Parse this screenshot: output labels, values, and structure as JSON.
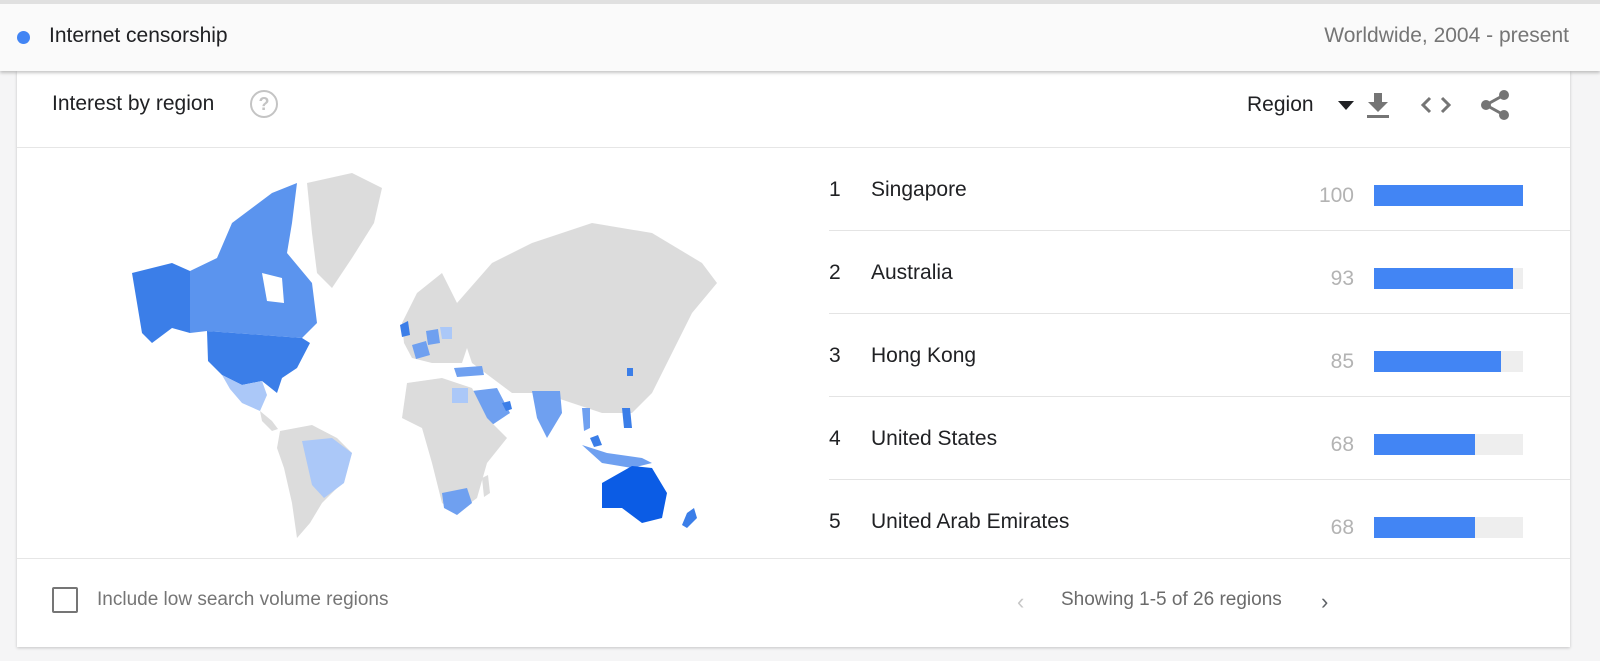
{
  "topbar": {
    "term_label": "Internet censorship",
    "term_color": "#4285f4",
    "scope": "Worldwide, 2004 - present"
  },
  "card": {
    "title": "Interest by region",
    "help_icon": "help-circle-icon",
    "region_select": {
      "selected": "Region"
    },
    "actions": [
      {
        "name": "download-icon",
        "label": "Download CSV"
      },
      {
        "name": "embed-icon",
        "label": "Embed"
      },
      {
        "name": "share-icon",
        "label": "Share"
      }
    ]
  },
  "regions": [
    {
      "rank": "1",
      "name": "Singapore",
      "value": "100",
      "fraction": 1.0
    },
    {
      "rank": "2",
      "name": "Australia",
      "value": "93",
      "fraction": 0.93
    },
    {
      "rank": "3",
      "name": "Hong Kong",
      "value": "85",
      "fraction": 0.85
    },
    {
      "rank": "4",
      "name": "United States",
      "value": "68",
      "fraction": 0.68
    },
    {
      "rank": "5",
      "name": "United Arab Emirates",
      "value": "68",
      "fraction": 0.68
    }
  ],
  "map": {
    "highlighted": [
      "Australia",
      "United States",
      "Canada",
      "Mexico",
      "Brazil",
      "South Africa",
      "United Kingdom",
      "France",
      "Germany",
      "Poland",
      "Turkey",
      "Egypt",
      "Saudi Arabia",
      "India",
      "Thailand",
      "Malaysia",
      "Indonesia",
      "Philippines",
      "South Korea",
      "New Zealand"
    ],
    "colors": {
      "max": "#0b5ce5",
      "high": "#3b7ee8",
      "mid": "#6fa0f0",
      "low": "#abc8f8",
      "none": "#dcdcdc"
    }
  },
  "footer": {
    "checkbox_label": "Include low search volume regions",
    "checkbox_checked": false,
    "pager_prev": "‹",
    "pager_text": "Showing 1-5 of 26 regions",
    "pager_next": "›"
  }
}
